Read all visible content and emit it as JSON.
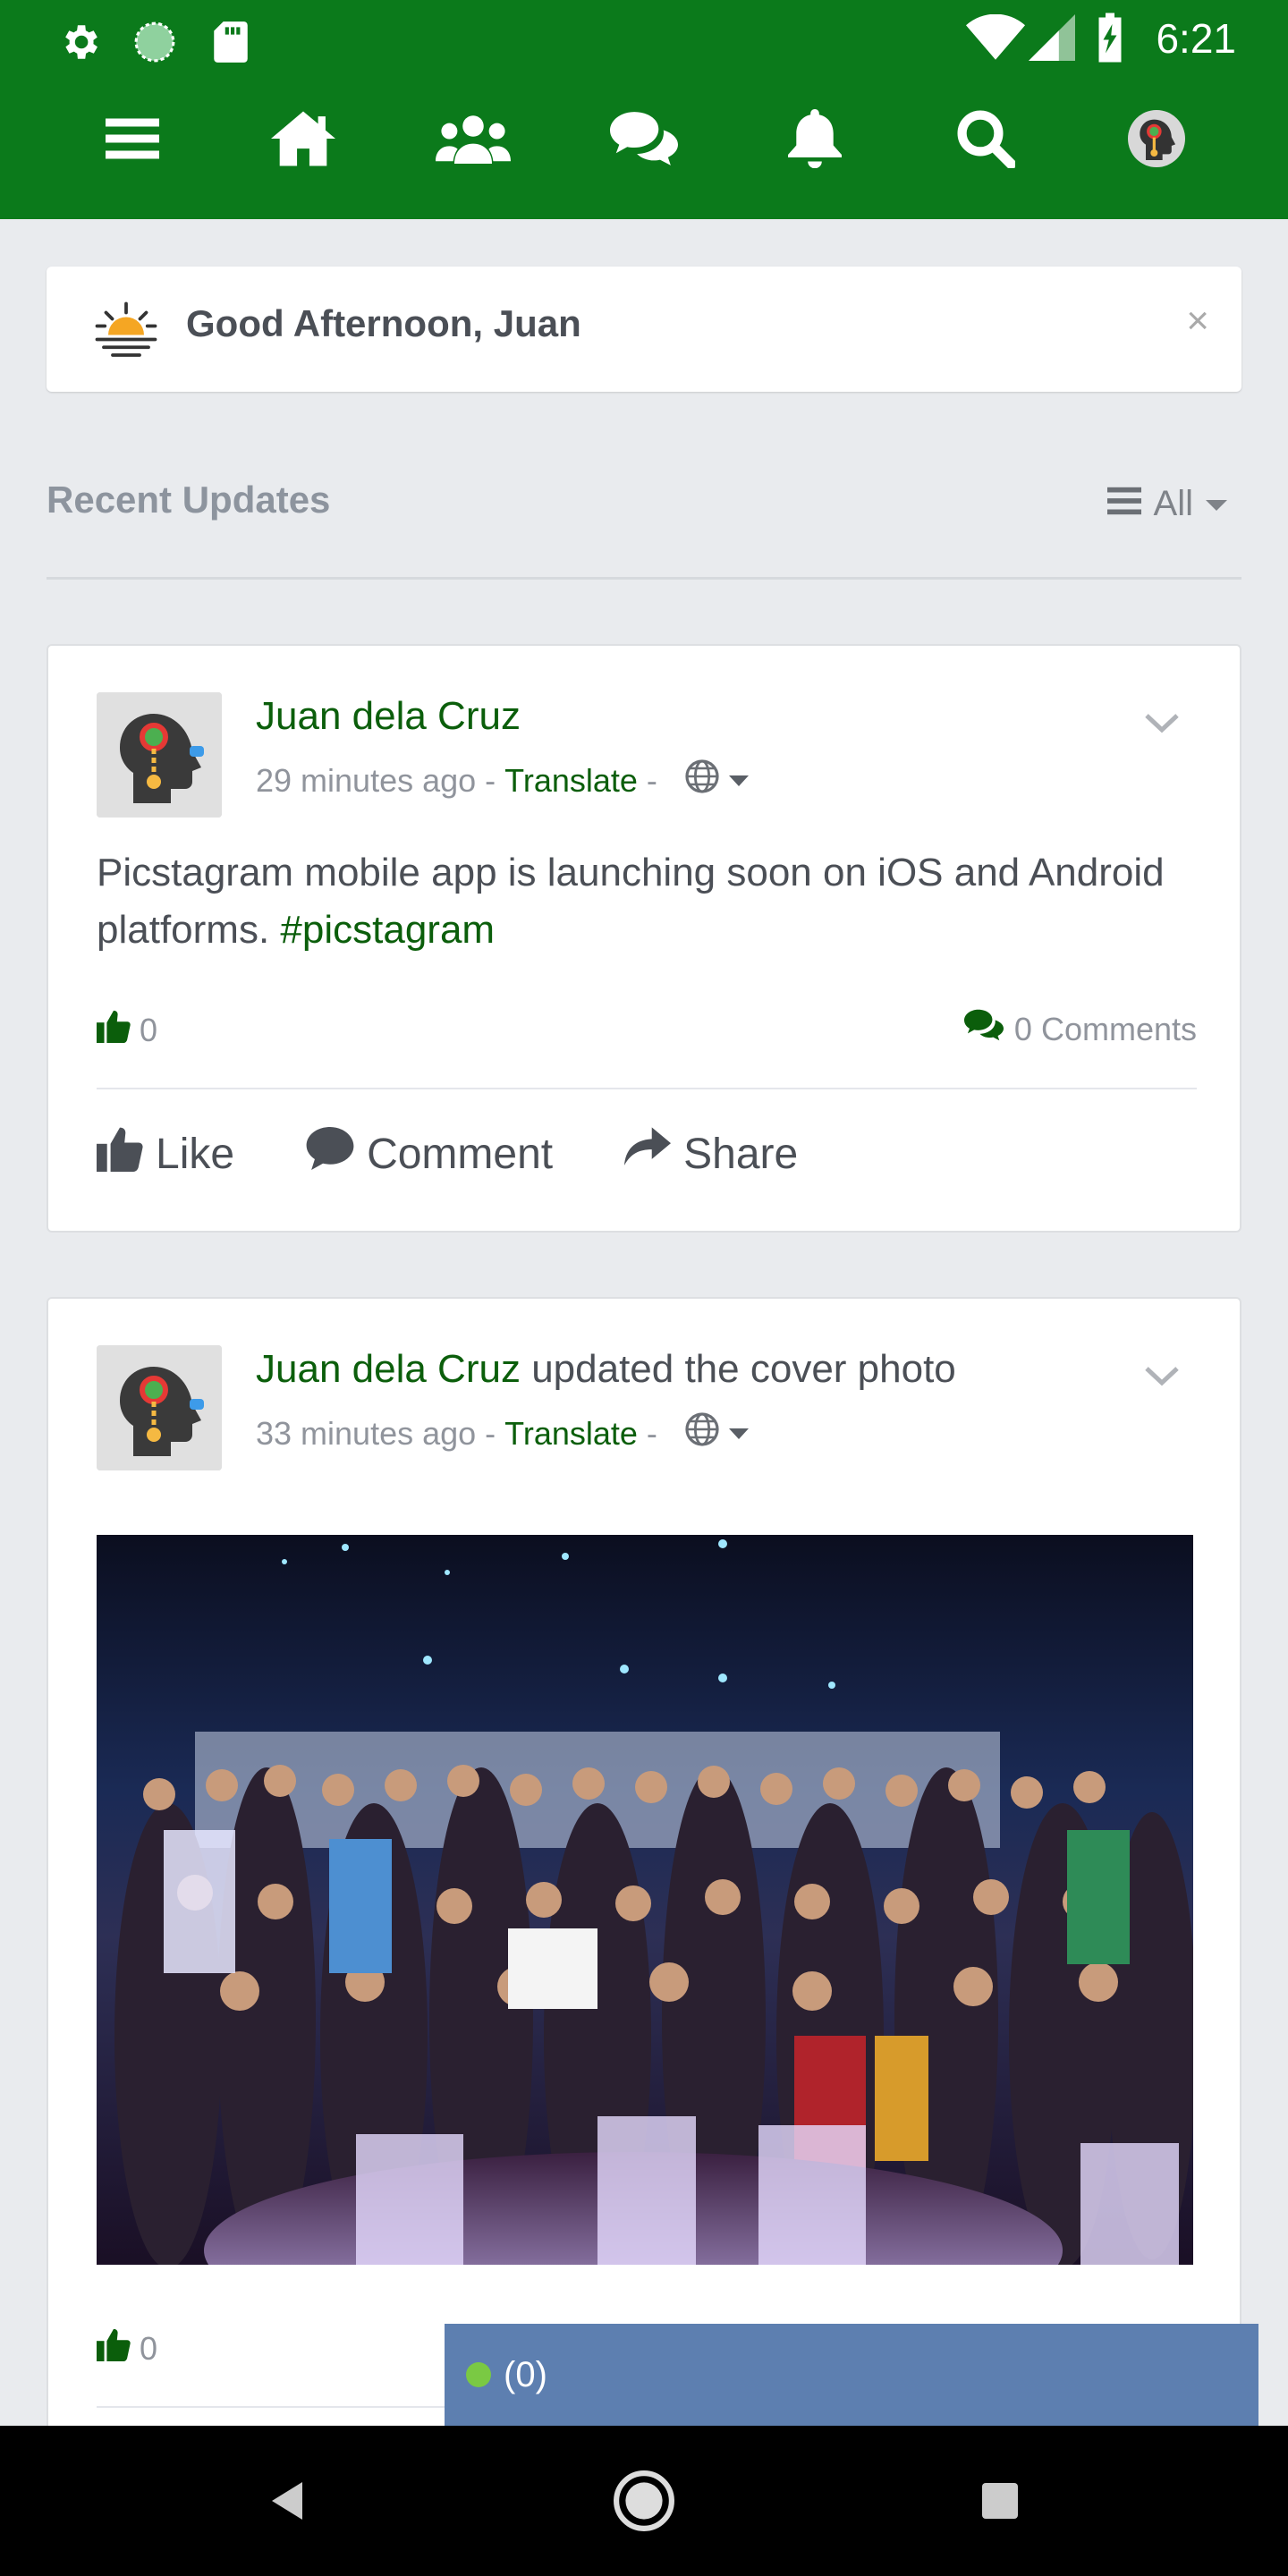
{
  "status_bar": {
    "time": "6:21"
  },
  "nav": {
    "items": [
      "menu-icon",
      "home-icon",
      "friends-icon",
      "messages-icon",
      "notifications-icon",
      "search-icon",
      "profile-icon"
    ]
  },
  "greeting": {
    "text": "Good Afternoon, Juan",
    "close": "×"
  },
  "recent": {
    "title": "Recent Updates",
    "filter_label": "All"
  },
  "posts": [
    {
      "author": "Juan dela Cruz",
      "action": "",
      "time": "29 minutes ago",
      "separator1": "-",
      "translate": "Translate",
      "separator2": "-",
      "text": "Picstagram mobile app is launching soon on iOS and Android platforms.",
      "hashtag": "#picstagram",
      "likes": "0",
      "comments": "0 Comments",
      "like_label": "Like",
      "comment_label": "Comment",
      "share_label": "Share"
    },
    {
      "author": "Juan dela Cruz",
      "action": "updated the cover photo",
      "time": "33 minutes ago",
      "separator1": "-",
      "translate": "Translate",
      "separator2": "-",
      "likes": "0"
    }
  ],
  "chat": {
    "label": "(0)"
  },
  "colors": {
    "brand": "#0b7a1b",
    "link": "#0b5e0b",
    "chat": "#5d7fb0",
    "online": "#7ac943"
  }
}
